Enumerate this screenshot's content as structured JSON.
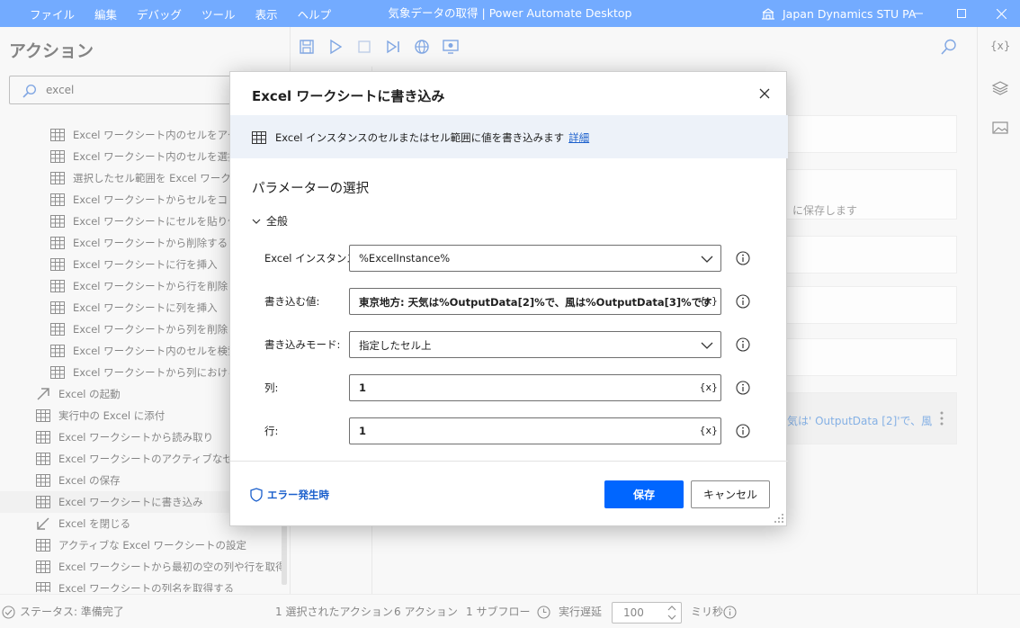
{
  "titlebar": {
    "menu": [
      "ファイル",
      "編集",
      "デバッグ",
      "ツール",
      "表示",
      "ヘルプ"
    ],
    "title": "気象データの取得 | Power Automate Desktop",
    "account": "Japan Dynamics STU PA",
    "color": "#0066ff"
  },
  "actions_panel": {
    "heading": "アクション",
    "search_value": "excel",
    "items": [
      {
        "label": "Excel ワークシート内のセルをアクティブ",
        "icon": "excel-table-icon"
      },
      {
        "label": "Excel ワークシート内のセルを選択",
        "icon": "excel-table-icon"
      },
      {
        "label": "選択したセル範囲を Excel ワークシー",
        "icon": "excel-table-icon"
      },
      {
        "label": "Excel ワークシートからセルをコピー",
        "icon": "excel-table-icon"
      },
      {
        "label": "Excel ワークシートにセルを貼り付け",
        "icon": "excel-table-icon"
      },
      {
        "label": "Excel ワークシートから削除する",
        "icon": "excel-table-icon"
      },
      {
        "label": "Excel ワークシートに行を挿入",
        "icon": "excel-table-icon"
      },
      {
        "label": "Excel ワークシートから行を削除",
        "icon": "excel-table-icon"
      },
      {
        "label": "Excel ワークシートに列を挿入",
        "icon": "excel-table-icon"
      },
      {
        "label": "Excel ワークシートから列を削除",
        "icon": "excel-table-icon"
      },
      {
        "label": "Excel ワークシート内のセルを検索して",
        "icon": "excel-table-icon"
      },
      {
        "label": "Excel ワークシートから列における最初の",
        "icon": "excel-table-icon"
      },
      {
        "label": "Excel の起動",
        "icon": "arrow-up-right-icon"
      },
      {
        "label": "実行中の Excel に添付",
        "icon": "excel-table-icon"
      },
      {
        "label": "Excel ワークシートから読み取り",
        "icon": "excel-table-icon"
      },
      {
        "label": "Excel ワークシートのアクティブなセルを取得",
        "icon": "excel-table-icon"
      },
      {
        "label": "Excel の保存",
        "icon": "excel-table-icon"
      },
      {
        "label": "Excel ワークシートに書き込み",
        "icon": "excel-table-icon",
        "selected": true
      },
      {
        "label": "Excel を閉じる",
        "icon": "arrow-down-left-icon"
      },
      {
        "label": "アクティブな Excel ワークシートの設定",
        "icon": "excel-table-icon"
      },
      {
        "label": "Excel ワークシートから最初の空の列や行を取得",
        "icon": "excel-table-icon"
      },
      {
        "label": "Excel ワークシートの列名を取得する",
        "icon": "excel-table-icon"
      }
    ]
  },
  "background": {
    "card2_text": "に保存します",
    "card6_text": "気は' OutputData [2]'で、風"
  },
  "rail": {
    "variables_label": "{x}"
  },
  "statusbar": {
    "status": "ステータス: 準備完了",
    "selected_actions": "1 選択されたアクション",
    "actions_count": "6 アクション",
    "subflows": "1 サブフロー",
    "delay_label": "実行遅延",
    "delay_value": "100",
    "unit": "ミリ秒"
  },
  "dialog": {
    "title": "Excel ワークシートに書き込み",
    "info_text": "Excel インスタンスのセルまたはセル範囲に値を書き込みます",
    "info_link": "詳細",
    "section_title": "パラメーターの選択",
    "group_label": "全般",
    "fields": {
      "instance": {
        "label": "Excel インスタンス:",
        "value": "%ExcelInstance%"
      },
      "value": {
        "label": "書き込む値:",
        "value": "東京地方: 天気は%OutputData[2]%で、風は%OutputData[3]%です",
        "var_badge": "{x}"
      },
      "mode": {
        "label": "書き込みモード:",
        "value": "指定したセル上"
      },
      "column": {
        "label": "列:",
        "value": "1",
        "var_badge": "{x}"
      },
      "row": {
        "label": "行:",
        "value": "1",
        "var_badge": "{x}"
      }
    },
    "on_error": "エラー発生時",
    "save_label": "保存",
    "cancel_label": "キャンセル",
    "accent": "#0066ff",
    "link_color": "#1a5fcc"
  }
}
